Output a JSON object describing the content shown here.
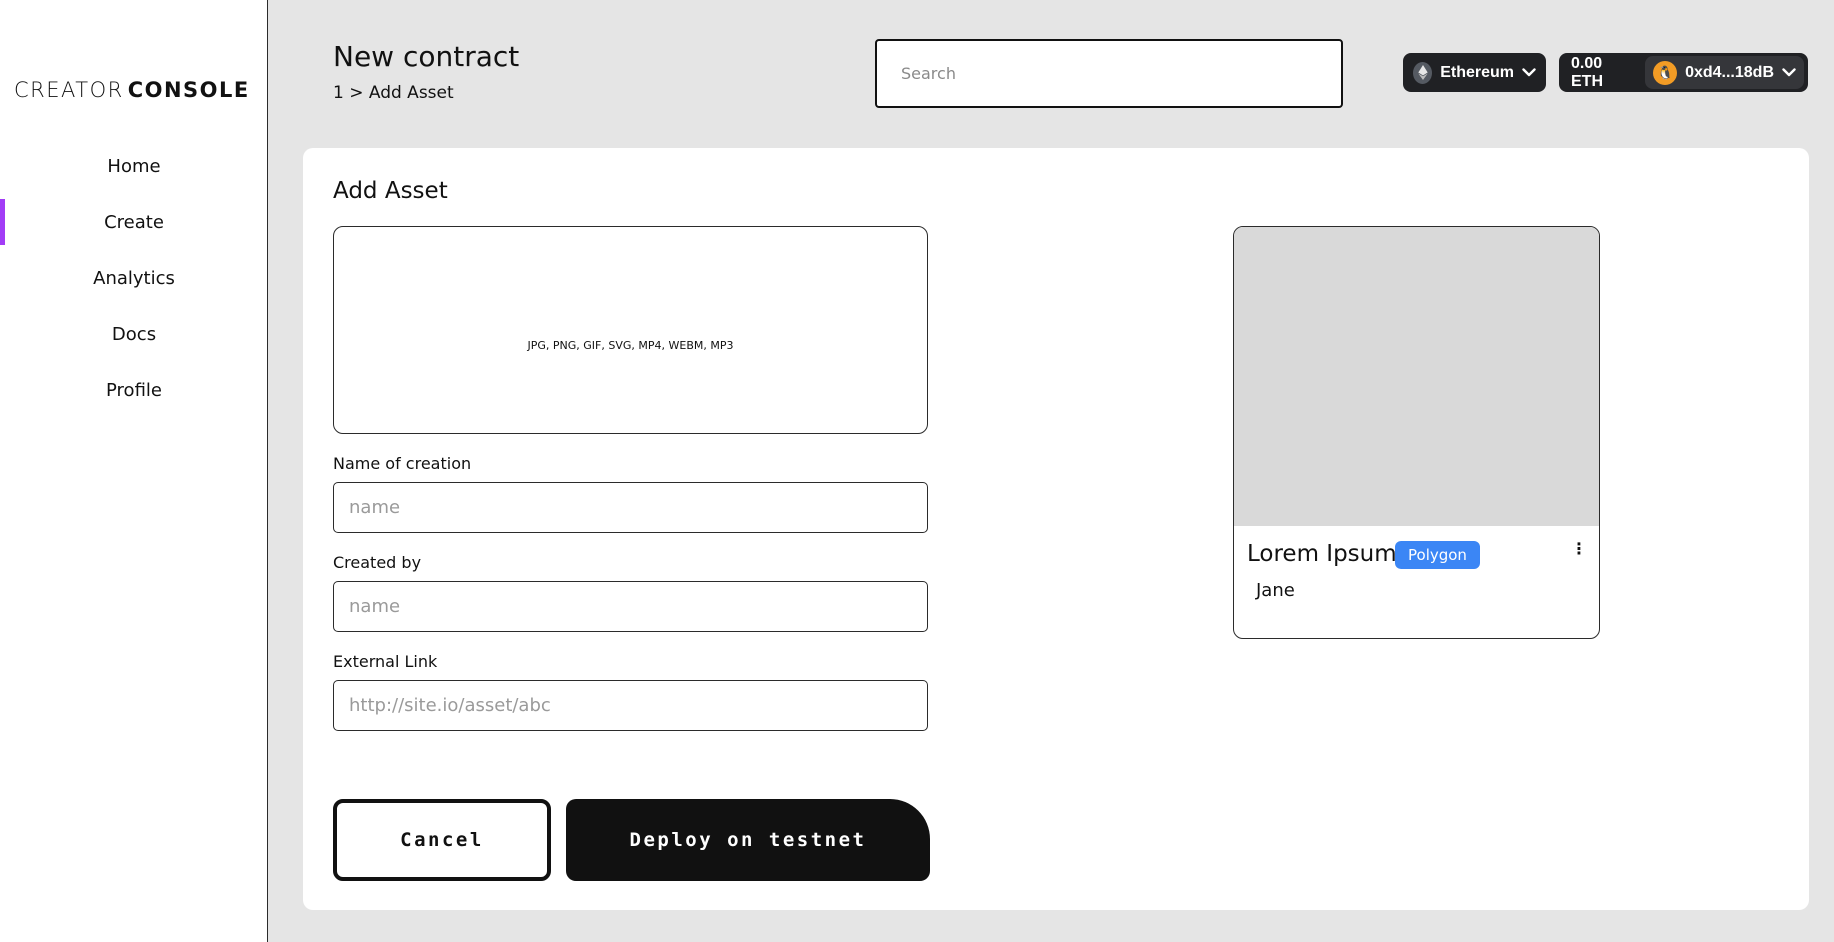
{
  "sidebar": {
    "logo": {
      "word1": "CREATOR",
      "word2": "CONSOLE"
    },
    "items": [
      {
        "label": "Home"
      },
      {
        "label": "Create"
      },
      {
        "label": "Analytics"
      },
      {
        "label": "Docs"
      },
      {
        "label": "Profile"
      }
    ],
    "active_item": "Create",
    "accent_color": "#a23cf6"
  },
  "header": {
    "title": "New contract",
    "breadcrumb": "1 > Add Asset",
    "search_placeholder": "Search",
    "network": {
      "label": "Ethereum",
      "icon": "ethereum-icon"
    },
    "wallet": {
      "balance": "0.00 ETH",
      "address": "0xd4...18dB",
      "avatar_icon": "penguin-avatar"
    }
  },
  "form": {
    "section_title": "Add Asset",
    "dropzone_text": "JPG, PNG, GIF, SVG, MP4, WEBM, MP3",
    "fields": [
      {
        "label": "Name of creation",
        "placeholder": "name"
      },
      {
        "label": "Created by",
        "placeholder": "name"
      },
      {
        "label": "External Link",
        "placeholder": "http://site.io/asset/abc"
      }
    ],
    "cancel_label": "Cancel",
    "deploy_label": "Deploy on testnet"
  },
  "preview": {
    "title": "Lorem Ipsum",
    "badge": "Polygon",
    "badge_color": "#3b86f5",
    "creator": "Jane",
    "menu_icon": "kebab-icon"
  }
}
